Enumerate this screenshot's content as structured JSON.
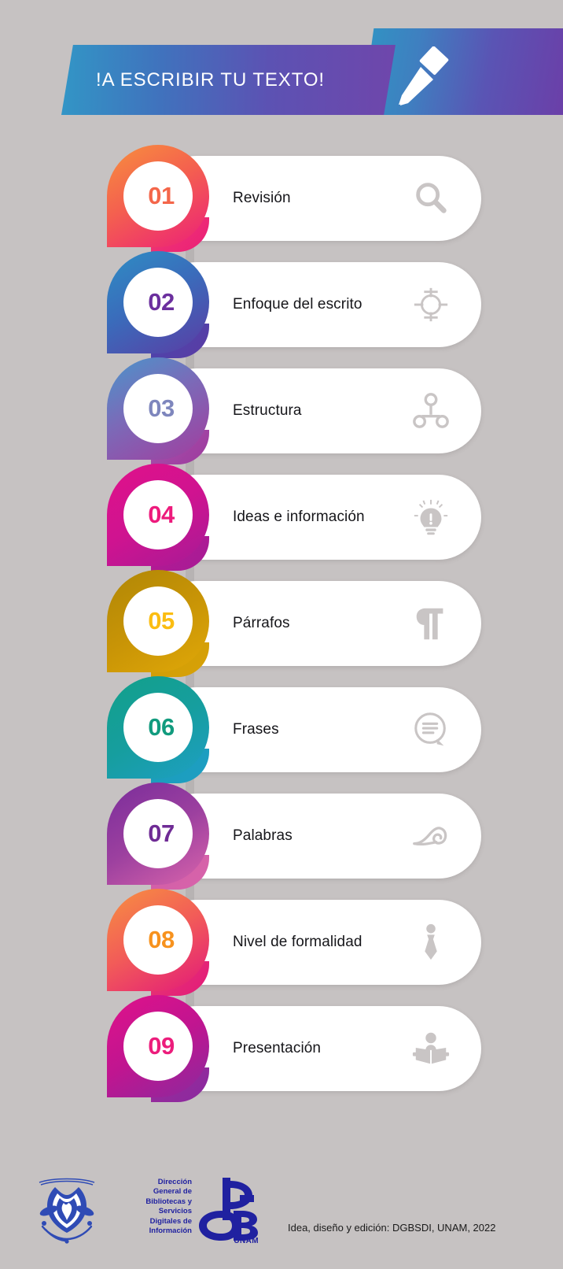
{
  "background_color": "#c6c2c2",
  "header": {
    "title": "!A ESCRIBIR TU TEXTO!",
    "icon": "pen-nib-icon",
    "gradient_from": "#3296c6",
    "gradient_to": "#6f46ab"
  },
  "steps": [
    {
      "number": "01",
      "label": "Revisión",
      "icon": "magnifier-icon",
      "num_color": "#f4664a",
      "badge_from": "#f7903d",
      "badge_to": "#ec1e79"
    },
    {
      "number": "02",
      "label": "Enfoque del escrito",
      "icon": "target-crosshair-icon",
      "num_color": "#6b2f9e",
      "badge_from": "#2e8ec4",
      "badge_to": "#5b3ca4"
    },
    {
      "number": "03",
      "label": "Estructura",
      "icon": "hierarchy-nodes-icon",
      "num_color": "#7e86bd",
      "badge_from": "#4a95cb",
      "badge_to": "#a33c9e"
    },
    {
      "number": "04",
      "label": "Ideas e información",
      "icon": "lightbulb-exclamation-icon",
      "num_color": "#ed1a7c",
      "badge_from": "#e0128a",
      "badge_to": "#a61b96"
    },
    {
      "number": "05",
      "label": "Párrafos",
      "icon": "pilcrow-icon",
      "num_color": "#fbbd12",
      "badge_from": "#b08706",
      "badge_to": "#e0a808"
    },
    {
      "number": "06",
      "label": "Frases",
      "icon": "speech-bubble-lines-icon",
      "num_color": "#119b7e",
      "badge_from": "#12a08a",
      "badge_to": "#1e9fc4"
    },
    {
      "number": "07",
      "label": "Palabras",
      "icon": "swirl-flourish-icon",
      "num_color": "#6f2b95",
      "badge_from": "#7a2d9b",
      "badge_to": "#d964ab"
    },
    {
      "number": "08",
      "label": "Nivel de formalidad",
      "icon": "necktie-icon",
      "num_color": "#f7921e",
      "badge_from": "#f79140",
      "badge_to": "#e2187a"
    },
    {
      "number": "09",
      "label": "Presentación",
      "icon": "person-reading-book-icon",
      "num_color": "#ec1d7c",
      "badge_from": "#e0128a",
      "badge_to": "#8a2a9e"
    }
  ],
  "footer": {
    "unam_shield": "unam-shield-icon",
    "dgb_text": "Dirección General de Bibliotecas y Servicios Digitales de Información",
    "dgb_monogram": "dgb-monogram-icon",
    "dgb_unam": "UNAM",
    "credit": "Idea, diseño y edición: DGBSDI, UNAM, 2022",
    "brand_color": "#2021a0"
  }
}
